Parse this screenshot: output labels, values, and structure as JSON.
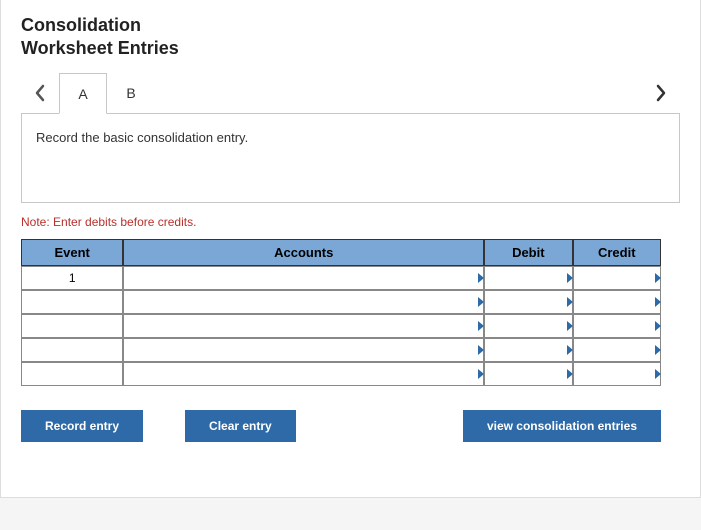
{
  "title_line1": "Consolidation",
  "title_line2": "Worksheet Entries",
  "tabs": {
    "a": "A",
    "b": "B"
  },
  "instruction": "Record the basic consolidation entry.",
  "note": "Note: Enter debits before credits.",
  "table": {
    "headers": {
      "event": "Event",
      "accounts": "Accounts",
      "debit": "Debit",
      "credit": "Credit"
    },
    "rows": [
      {
        "event": "1",
        "accounts": "",
        "debit": "",
        "credit": ""
      },
      {
        "event": "",
        "accounts": "",
        "debit": "",
        "credit": ""
      },
      {
        "event": "",
        "accounts": "",
        "debit": "",
        "credit": ""
      },
      {
        "event": "",
        "accounts": "",
        "debit": "",
        "credit": ""
      },
      {
        "event": "",
        "accounts": "",
        "debit": "",
        "credit": ""
      }
    ]
  },
  "buttons": {
    "record": "Record entry",
    "clear": "Clear entry",
    "view": "view consolidation entries"
  }
}
